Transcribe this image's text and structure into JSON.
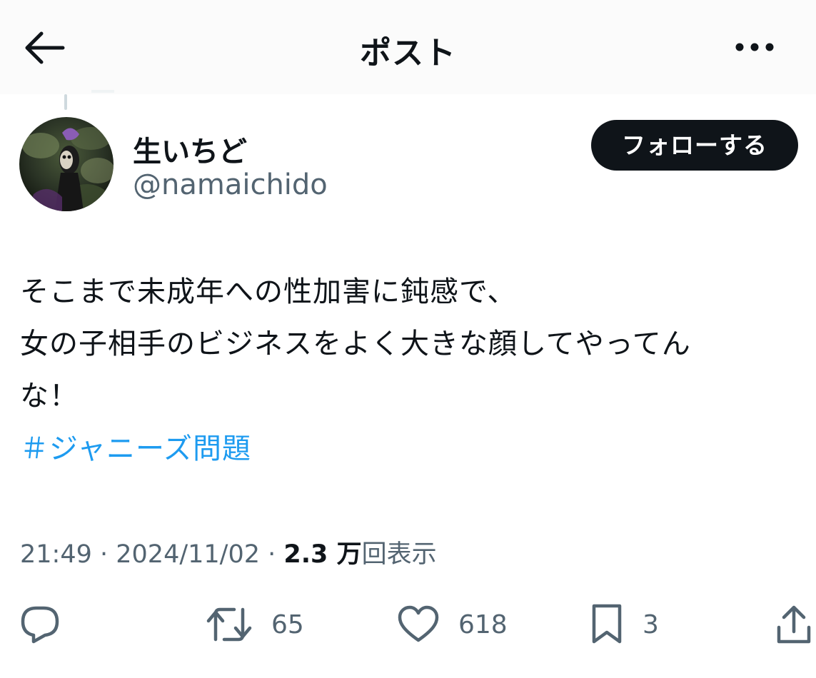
{
  "header": {
    "title": "ポスト",
    "back_icon": "arrow-left-icon",
    "more_icon": "ellipsis-icon"
  },
  "author": {
    "display_name": "生いちど",
    "handle": "@namaichido",
    "follow_label": "フォローする"
  },
  "tweet": {
    "lines": [
      "そこまで未成年への性加害に鈍感で、",
      "女の子相手のビジネスをよく大きな顔してやってん",
      "な！"
    ],
    "hashtag": "＃ジャニーズ問題"
  },
  "meta": {
    "time": "21:49",
    "separator": " · ",
    "date": "2024/11/02",
    "views_count": "2.3 万",
    "views_label": "回表示"
  },
  "actions": {
    "reply": {
      "icon": "reply-bubble-icon"
    },
    "repost": {
      "icon": "repost-icon",
      "count": "65"
    },
    "like": {
      "icon": "heart-icon",
      "count": "618"
    },
    "bookmark": {
      "icon": "bookmark-icon",
      "count": "3"
    },
    "share": {
      "icon": "share-icon"
    }
  },
  "colors": {
    "text": "#0f1419",
    "secondary": "#536471",
    "link": "#1d9bf0",
    "button_bg": "#0f1419",
    "header_bg": "#fbfbfb"
  }
}
